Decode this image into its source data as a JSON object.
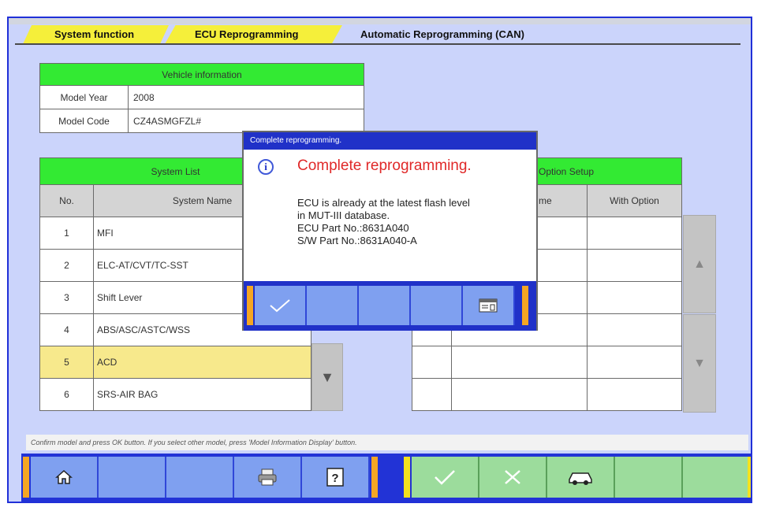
{
  "breadcrumb": {
    "items": [
      "System function",
      "ECU Reprogramming"
    ],
    "current": "Automatic Reprogramming (CAN)"
  },
  "vehicle_info": {
    "header": "Vehicle information",
    "rows": [
      {
        "label": "Model Year",
        "value": "2008"
      },
      {
        "label": "Model Code",
        "value": "CZ4ASMGFZL#"
      }
    ]
  },
  "system_list": {
    "header": "System List",
    "col_no": "No.",
    "col_name": "System Name",
    "rows": [
      {
        "no": "1",
        "name": "MFI"
      },
      {
        "no": "2",
        "name": "ELC-AT/CVT/TC-SST"
      },
      {
        "no": "3",
        "name": "Shift Lever"
      },
      {
        "no": "4",
        "name": "ABS/ASC/ASTC/WSS"
      },
      {
        "no": "5",
        "name": "ACD"
      },
      {
        "no": "6",
        "name": "SRS-AIR BAG"
      }
    ],
    "selected_index": 4
  },
  "option_setup": {
    "header": "Option Setup",
    "col_name": "me",
    "col_with": "With Option"
  },
  "dialog": {
    "title": "Complete reprogramming.",
    "heading": "Complete reprogramming.",
    "lines": [
      "ECU is already at the latest flash level",
      "in MUT-III database.",
      "ECU Part No.:8631A040",
      "S/W Part No.:8631A040-A"
    ]
  },
  "status_text": "Confirm model and press OK button. If you select other model, press 'Model Information Display' button.",
  "colors": {
    "header_green": "#33ea33",
    "selected_row": "#f7e98c",
    "breadcrumb_yellow": "#f5ef3a",
    "toolbar_blue": "#2233d6",
    "dialog_heading_red": "#e02828"
  },
  "icons": {
    "home": "home-icon",
    "print": "printer-icon",
    "help": "help-icon",
    "ok": "checkmark-icon",
    "cancel": "cross-icon",
    "vehicle": "car-icon",
    "info": "info-icon",
    "data": "data-window-icon"
  }
}
